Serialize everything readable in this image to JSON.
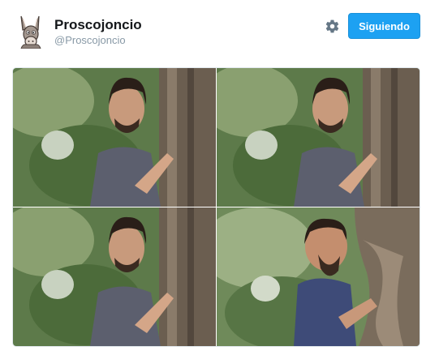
{
  "profile": {
    "display_name": "Proscojoncio",
    "handle": "@Proscojoncio"
  },
  "actions": {
    "follow_label": "Siguiendo"
  },
  "icons": {
    "avatar": "donkey-icon",
    "settings": "gear-icon"
  },
  "colors": {
    "accent": "#1da1f2",
    "name_text": "#14171a",
    "handle_text": "#8899a6"
  },
  "media": {
    "panels": [
      "peek-photo-1",
      "peek-photo-2",
      "peek-photo-3",
      "peek-photo-4"
    ]
  }
}
